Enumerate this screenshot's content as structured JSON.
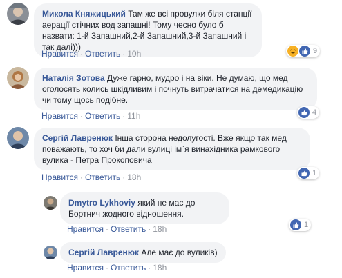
{
  "actions": {
    "like": "Нравится",
    "reply": "Ответить",
    "sep": "·"
  },
  "colors": {
    "name": "#385898",
    "bubble": "#f2f3f5",
    "like": "#4267b2",
    "haha": "#f7b125",
    "love": "#f25268"
  },
  "comments": [
    {
      "author": "Микола Княжицький",
      "text": "Там же всі провулки біля станції аерації стічних вод запашні! Тому чесно було б назвати: 1-й Запашний,2-й Запашний,3-й Запашний і так далі)))",
      "time": "10h",
      "reactions": [
        "haha-icon",
        "like-icon"
      ],
      "count": "9"
    },
    {
      "author": "Наталія Зотова",
      "text": "Дуже гарно, мудро і на віки. Не думаю, що мед оголосять колись шкідливим і почнуть витрачатися на демедикацію чи тому щось подібне.",
      "time": "11h",
      "reactions": [
        "like-icon"
      ],
      "count": "4"
    },
    {
      "author": "Сергій Лавренюк",
      "text": "Інша сторона недолугості. Вже якщо так мед поважають, то хоч би дали вулиці ім`я винахідника рамкового вулика - Петра Прокоповича",
      "time": "18h",
      "reactions": [
        "like-icon"
      ],
      "count": "1"
    }
  ],
  "replies": [
    {
      "author": "Dmytro Lykhoviy",
      "text": "який не має до Бортнич жодного відношення.",
      "time": "18h",
      "reactions": [
        "like-icon"
      ],
      "count": "1"
    },
    {
      "author": "Сергій Лавренюк",
      "text": "Але має до вуликів)",
      "time": "18h"
    }
  ]
}
